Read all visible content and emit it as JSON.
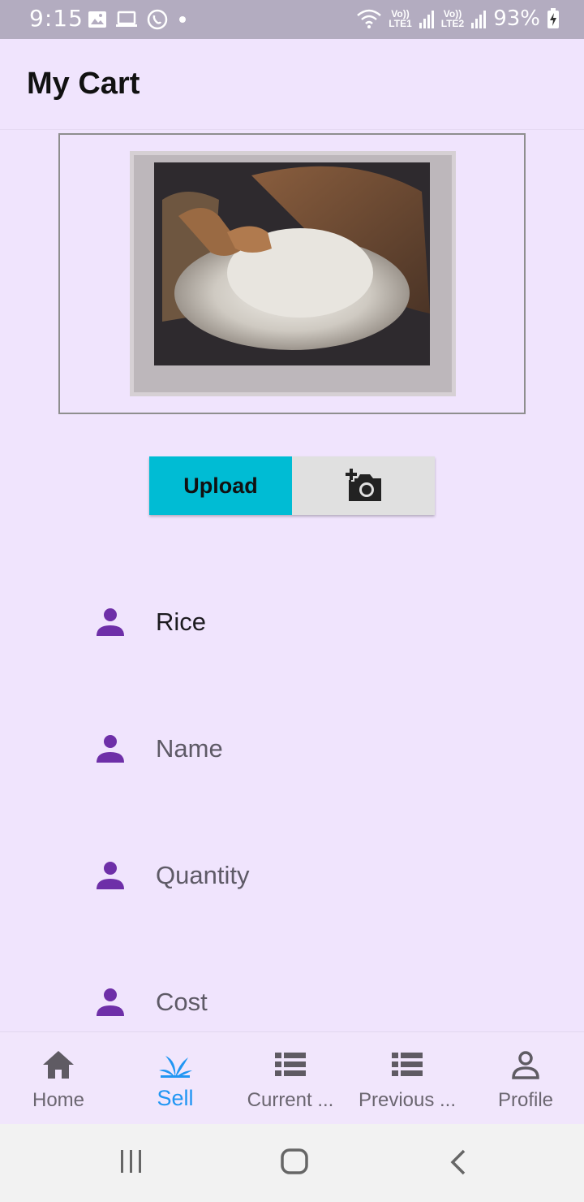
{
  "status": {
    "time": "9:15",
    "net1": "LTE1",
    "net2": "LTE2",
    "vo": "Vo))",
    "battery": "93%"
  },
  "header": {
    "title": "My Cart"
  },
  "actions": {
    "upload_label": "Upload",
    "camera_icon": "add-a-photo-icon"
  },
  "form": {
    "product": "Rice",
    "name_placeholder": "Name",
    "quantity_placeholder": "Quantity",
    "cost_placeholder": "Cost",
    "field_icon": "person-icon",
    "icon_color": "#6e2fa8"
  },
  "nav": {
    "items": [
      {
        "label": "Home",
        "icon": "home-icon"
      },
      {
        "label": "Sell",
        "icon": "sprout-icon",
        "active": true
      },
      {
        "label": "Current ...",
        "icon": "list-icon"
      },
      {
        "label": "Previous ...",
        "icon": "list-icon"
      },
      {
        "label": "Profile",
        "icon": "person-outline-icon"
      }
    ]
  },
  "colors": {
    "accent": "#00bcd4",
    "active_nav": "#2196f3",
    "background": "#f0e4fd"
  }
}
